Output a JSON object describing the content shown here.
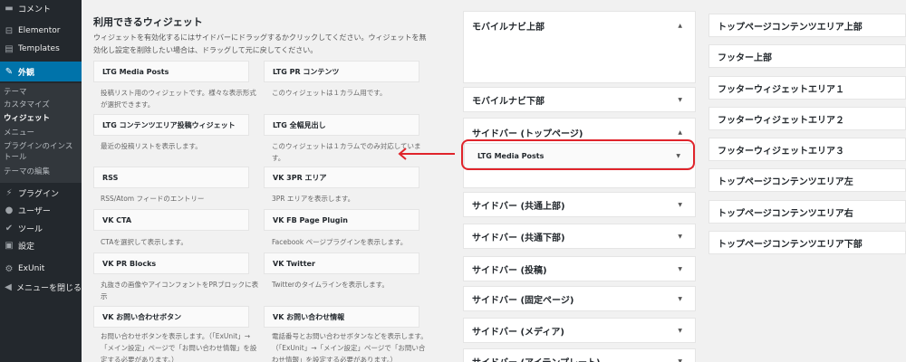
{
  "sidebar": {
    "top_items": [
      {
        "label": "コメント",
        "icon": "comment-icon",
        "glyph": "▬"
      },
      {
        "label": "Elementor",
        "icon": "elementor-icon",
        "glyph": "⊟"
      },
      {
        "label": "Templates",
        "icon": "folder-icon",
        "glyph": "▤"
      }
    ],
    "active": {
      "label": "外観",
      "icon": "appearance-brush-icon",
      "glyph": "✎"
    },
    "submenu": [
      "テーマ",
      "カスタマイズ",
      "ウィジェット",
      "メニュー",
      "プラグインのインストール",
      "テーマの編集"
    ],
    "bottom_items": [
      {
        "label": "プラグイン",
        "icon": "plugin-icon",
        "glyph": "⚡"
      },
      {
        "label": "ユーザー",
        "icon": "user-icon",
        "glyph": "●"
      },
      {
        "label": "ツール",
        "icon": "wrench-icon",
        "glyph": "✔"
      },
      {
        "label": "設定",
        "icon": "settings-icon",
        "glyph": "▣"
      },
      {
        "label": "ExUnit",
        "icon": "exunit-icon",
        "glyph": "⚙"
      },
      {
        "label": "メニューを閉じる",
        "icon": "collapse-menu-icon",
        "glyph": "◀"
      }
    ]
  },
  "available": {
    "title": "利用できるウィジェット",
    "desc": "ウィジェットを有効化するにはサイドバーにドラッグするかクリックしてください。ウィジェットを無効化し設定を削除したい場合は、ドラッグして元に戻してください。",
    "widgets": [
      {
        "name": "LTG Media Posts",
        "desc": "投稿リスト用のウィジェットです。様々な表示形式が選択できます。"
      },
      {
        "name": "LTG PR コンテンツ",
        "desc": "このウィジェットは１カラム用です。"
      },
      {
        "name": "LTG コンテンツエリア投稿ウィジェット",
        "desc": "最近の投稿リストを表示します。"
      },
      {
        "name": "LTG 全幅見出し",
        "desc": "このウィジェットは１カラムでのみ対応しています。"
      },
      {
        "name": "RSS",
        "desc": "RSS/Atom フィードのエントリー"
      },
      {
        "name": "VK 3PR エリア",
        "desc": "3PR エリアを表示します。"
      },
      {
        "name": "VK CTA",
        "desc": "CTAを選択して表示します。"
      },
      {
        "name": "VK FB Page Plugin",
        "desc": "Facebook ページプラグインを表示します。"
      },
      {
        "name": "VK PR Blocks",
        "desc": "丸抜きの画像やアイコンフォントをPRブロックに表示"
      },
      {
        "name": "VK Twitter",
        "desc": "Twitterのタイムラインを表示します。"
      },
      {
        "name": "VK お問い合わせボタン",
        "desc": "お問い合わせボタンを表示します。（「ExUnit」→「メイン設定」ページで「お問い合わせ情報」を設定する必要があります。）"
      },
      {
        "name": "VK お問い合わせ情報",
        "desc": "電話番号とお問い合わせボタンなどを表示します。（「ExUnit」→「メイン設定」ページで「お問い合わせ情報」を設定する必要があります。）"
      }
    ]
  },
  "areas_col1": [
    {
      "title": "モバイルナビ上部",
      "open": true
    },
    {
      "title": "モバイルナビ下部",
      "open": false
    },
    {
      "title": "サイドバー (トップページ)",
      "open": true
    },
    {
      "title": "サイドバー (共通上部)",
      "open": false
    },
    {
      "title": "サイドバー (共通下部)",
      "open": false
    },
    {
      "title": "サイドバー (投稿)",
      "open": false
    },
    {
      "title": "サイドバー (固定ページ)",
      "open": false
    },
    {
      "title": "サイドバー (メディア)",
      "open": false
    },
    {
      "title": "サイドバー (アイテンプレート)",
      "open": false
    }
  ],
  "placed_widget": {
    "name": "LTG Media Posts"
  },
  "areas_col2": [
    "トップページコンテンツエリア上部",
    "フッター上部",
    "フッターウィジェットエリア１",
    "フッターウィジェットエリア２",
    "フッターウィジェットエリア３",
    "トップページコンテンツエリア左",
    "トップページコンテンツエリア右",
    "トップページコンテンツエリア下部"
  ],
  "colors": {
    "highlight": "#e0242b",
    "active": "#0073aa",
    "sidebar": "#23282d"
  }
}
